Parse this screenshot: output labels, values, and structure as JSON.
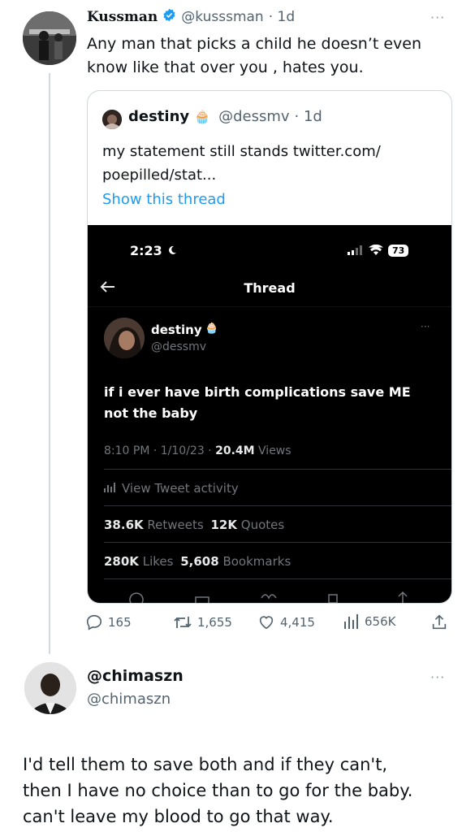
{
  "tweet": {
    "display_name": "Kussman",
    "handle": "@kusssman",
    "time": "· 1d",
    "text": "Any man that picks a child he doesn’t even know like that over you , hates you.",
    "more": "···"
  },
  "quote": {
    "display_name": "destiny",
    "emoji": "🧁",
    "handle": "@dessmv",
    "time": "· 1d",
    "text_line1": "my statement still stands twitter.com/",
    "text_line2": "poepilled/stat...",
    "show_thread": "Show this thread"
  },
  "screenshot": {
    "status_time": "2:23",
    "battery": "73",
    "header_title": "Thread",
    "display_name": "destiny",
    "handle": "@dessmv",
    "more": "···",
    "text_line1": "if i ever have birth complications save ME",
    "text_line2": "not the baby",
    "timestamp": "8:10 PM · 1/10/23 · ",
    "views_count": "20.4M",
    "views_label": "Views",
    "activity": "View Tweet activity",
    "retweets_count": "38.6K",
    "retweets_label": "Retweets",
    "quotes_count": "12K",
    "quotes_label": "Quotes",
    "likes_count": "280K",
    "likes_label": "Likes",
    "bookmarks_count": "5,608",
    "bookmarks_label": "Bookmarks"
  },
  "actions": {
    "replies": "165",
    "retweets": "1,655",
    "likes": "4,415",
    "views": "656K"
  },
  "reply": {
    "display_name": "@chimaszn",
    "handle": "@chimaszn",
    "more": "···",
    "line1": "I'd tell them to save both and if they can't,",
    "line2": "then I have no choice than to go for the baby.",
    "line3": "can't leave my blood to go that way."
  },
  "colors": {
    "link": "#1d9bf0",
    "verified": "#1d9bf0",
    "muted": "#536471",
    "border": "#cfd9de"
  }
}
